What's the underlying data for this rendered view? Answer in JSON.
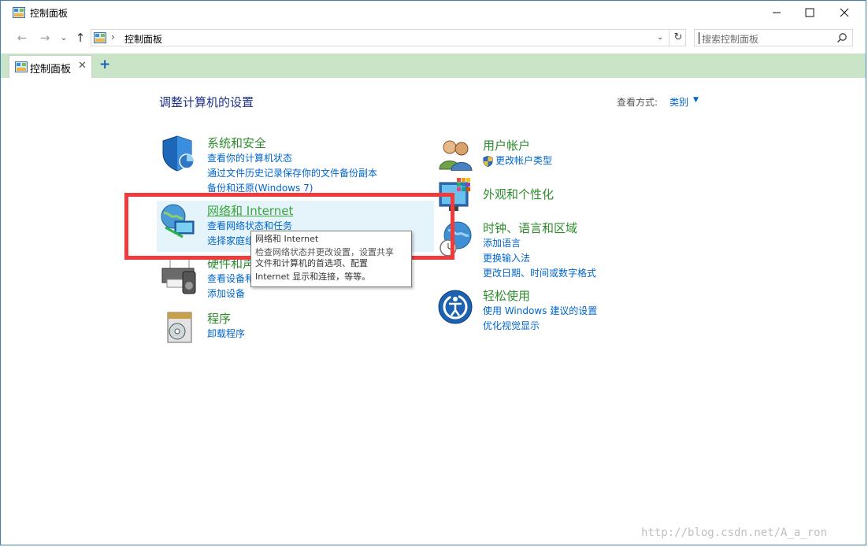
{
  "window": {
    "title": "控制面板",
    "minimize_glyph": "—",
    "maximize_glyph": "☐",
    "close_glyph": "✕"
  },
  "nav": {
    "back_glyph": "←",
    "forward_glyph": "→",
    "recent_glyph": "⌄",
    "up_glyph": "↑"
  },
  "address": {
    "separator": "›",
    "path": "控制面板",
    "dropdown_glyph": "⌄",
    "refresh_glyph": "↻"
  },
  "search": {
    "placeholder": "搜索控制面板"
  },
  "tabs": [
    {
      "label": "控制面板",
      "close": "✕"
    }
  ],
  "tab_add": "+",
  "heading": "调整计算机的设置",
  "view_by": {
    "label": "查看方式:",
    "value": "类别",
    "arrow": "▼"
  },
  "categories": {
    "system_security": {
      "title": "系统和安全",
      "links": [
        "查看你的计算机状态",
        "通过文件历史记录保存你的文件备份副本",
        "备份和还原(Windows 7)"
      ]
    },
    "network_internet": {
      "title": "网络和 Internet",
      "links": [
        "查看网络状态和任务",
        "选择家庭组"
      ]
    },
    "hardware_sound": {
      "title": "硬件和声",
      "links": [
        "查看设备和",
        "添加设备"
      ]
    },
    "programs": {
      "title": "程序",
      "links": [
        "卸载程序"
      ]
    },
    "user_accounts": {
      "title": "用户帐户",
      "links": [
        "更改帐户类型"
      ]
    },
    "appearance": {
      "title": "外观和个性化",
      "links": []
    },
    "clock_region": {
      "title": "时钟、语言和区域",
      "links": [
        "添加语言",
        "更换输入法",
        "更改日期、时间或数字格式"
      ]
    },
    "ease_of_access": {
      "title": "轻松使用",
      "links": [
        "使用 Windows 建议的设置",
        "优化视觉显示"
      ]
    }
  },
  "tooltip": {
    "title": "网络和 Internet",
    "line1": "检查网络状态并更改设置，设置共享",
    "line2": "文件和计算机的首选项、配置",
    "line3": "Internet 显示和连接，等等。"
  },
  "watermark": "http://blog.csdn.net/A_a_ron",
  "colors": {
    "tabstrip_bg": "#c9e4c6",
    "link_blue": "#0066cc",
    "category_green": "#2e8b2e",
    "heading_blue": "#1e3287",
    "highlight_red": "#ef3b3b"
  }
}
